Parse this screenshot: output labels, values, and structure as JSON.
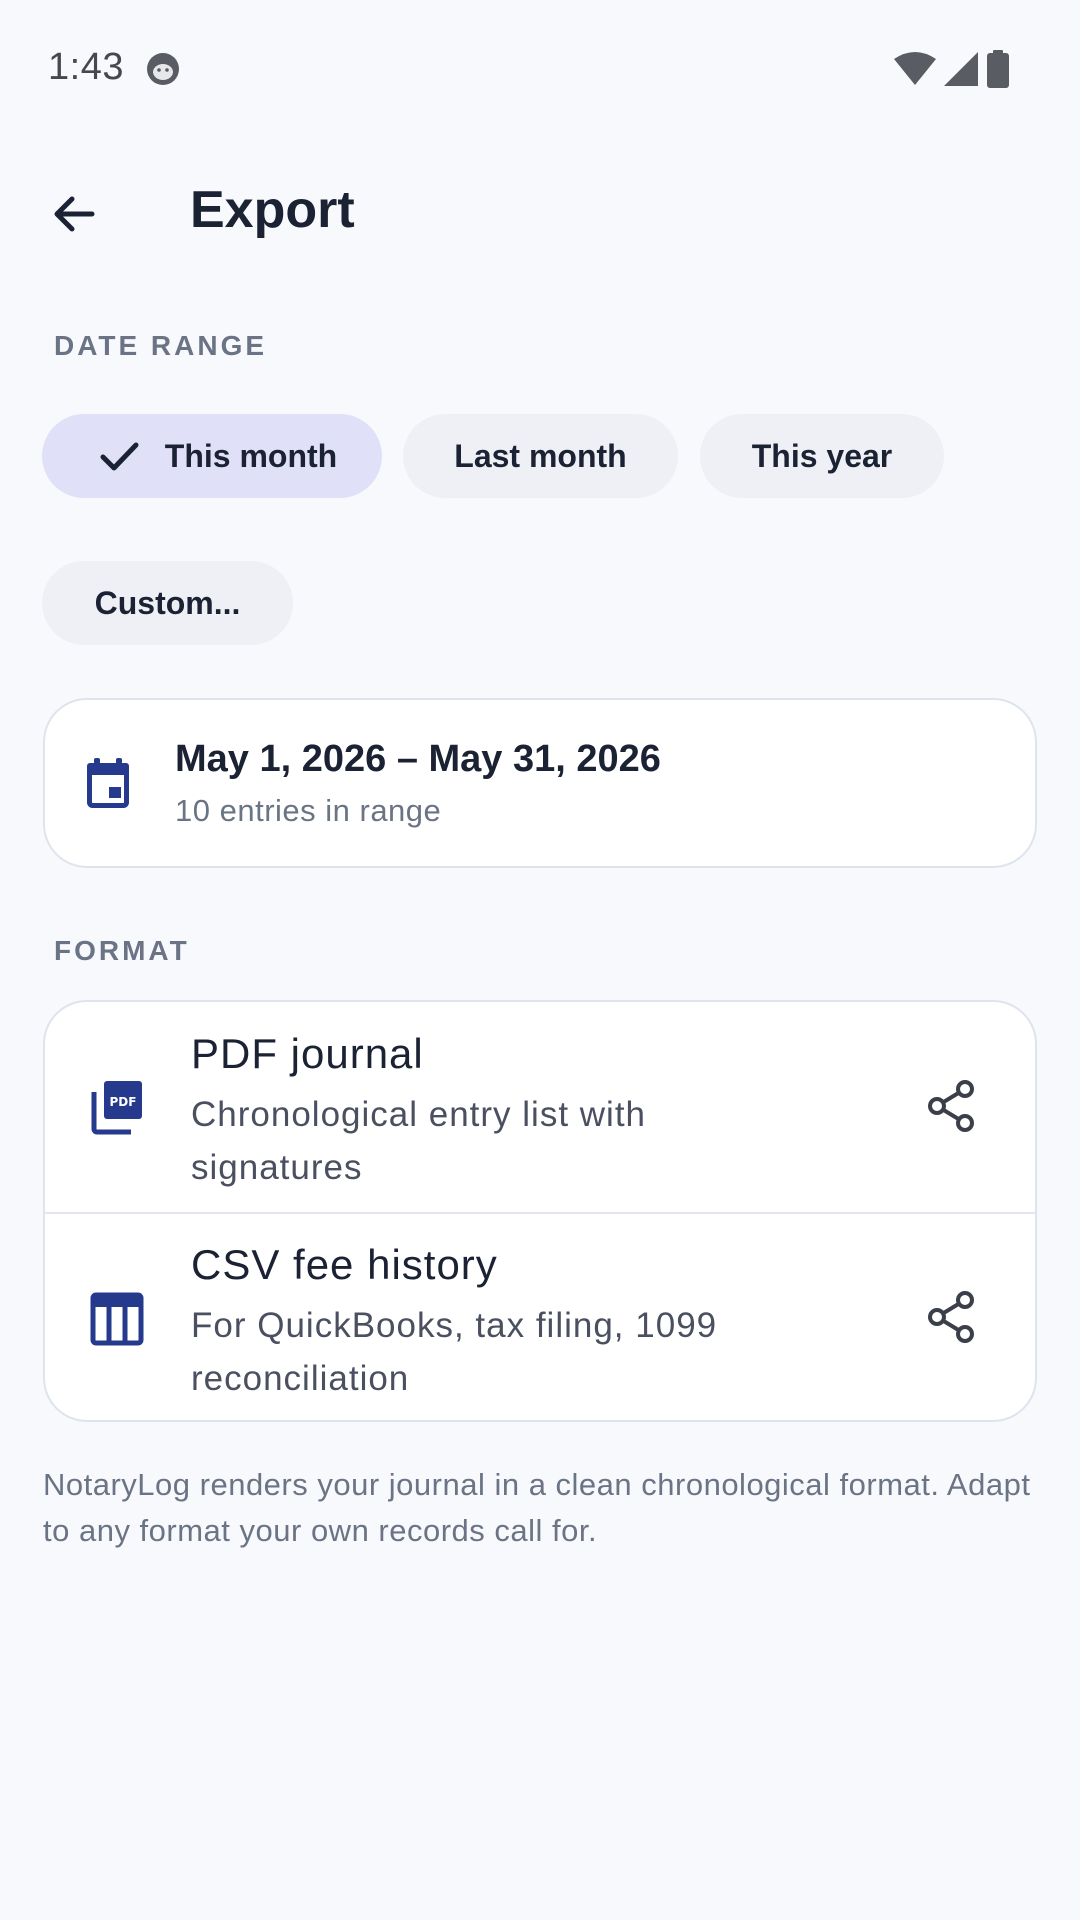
{
  "status_bar": {
    "time": "1:43"
  },
  "header": {
    "title": "Export"
  },
  "date_range": {
    "section_label": "DATE RANGE",
    "chips": [
      {
        "label": "This month",
        "selected": true
      },
      {
        "label": "Last month",
        "selected": false
      },
      {
        "label": "This year",
        "selected": false
      },
      {
        "label": "Custom...",
        "selected": false
      }
    ],
    "summary": {
      "range": "May 1, 2026 – May 31, 2026",
      "count": "10 entries in range"
    }
  },
  "format": {
    "section_label": "FORMAT",
    "options": [
      {
        "title": "PDF journal",
        "description": "Chronological entry list with signatures",
        "icon": "pdf-icon"
      },
      {
        "title": "CSV fee history",
        "description": "For QuickBooks, tax filing, 1099 reconciliation",
        "icon": "table-icon"
      }
    ]
  },
  "footer": {
    "note": "NotaryLog renders your journal in a clean chronological format. Adapt to any format your own records call for."
  },
  "colors": {
    "background": "#f8f9fc",
    "accent": "#253a8c",
    "chip_selected": "#e0e1f8",
    "chip": "#eef0f6",
    "text_primary": "#1b2233",
    "text_secondary": "#6b7485"
  }
}
